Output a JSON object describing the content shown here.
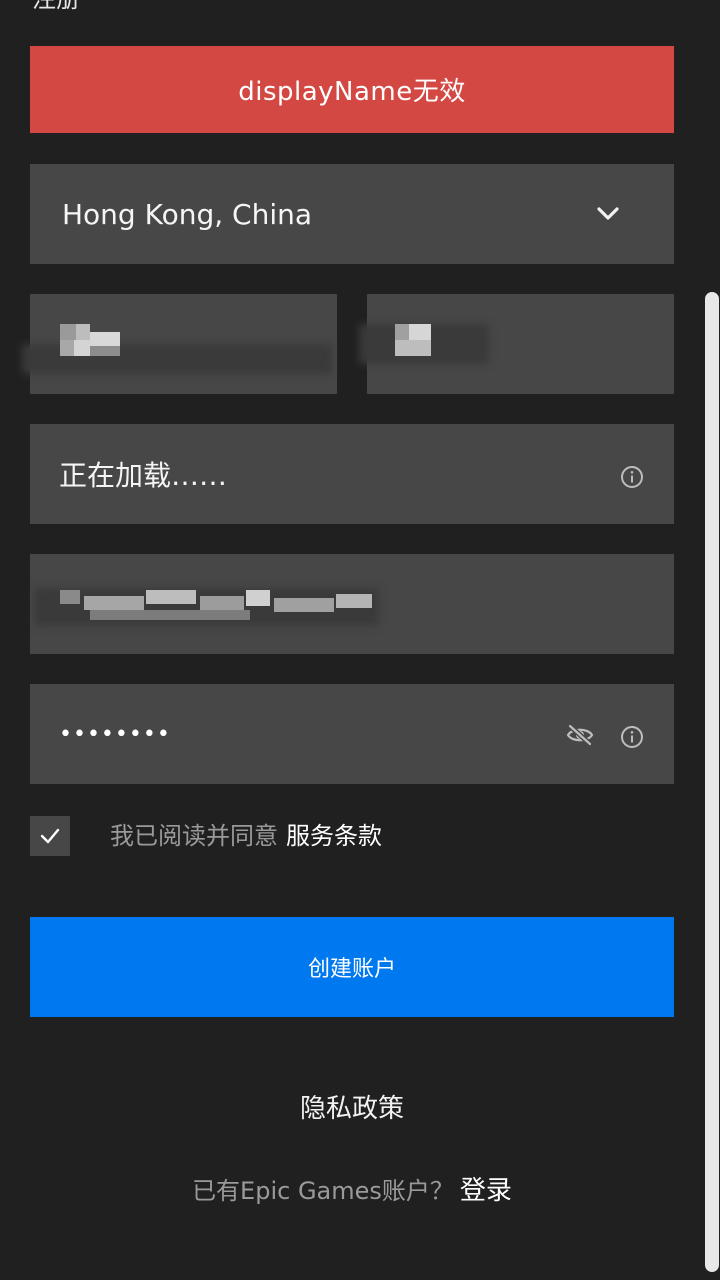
{
  "page": {
    "title": "注册"
  },
  "error_banner": {
    "message": "displayName无效",
    "color": "#d44843"
  },
  "form": {
    "country": {
      "value": "Hong Kong, China"
    },
    "first_name": {
      "value": ""
    },
    "last_name": {
      "value": ""
    },
    "display_name": {
      "value": "正在加载……"
    },
    "email": {
      "value": ""
    },
    "password": {
      "value": "••••••••"
    },
    "terms": {
      "checked": true,
      "prefix": "我已阅读并同意",
      "link": "服务条款"
    },
    "submit_label": "创建账户",
    "submit_color": "#0078f0"
  },
  "footer": {
    "privacy_label": "隐私政策",
    "login_prompt": "已有Epic Games账户？",
    "login_label": "登录"
  },
  "icons": {
    "country": "chevron-down-icon",
    "display_name": "info-icon",
    "password_visibility": "eye-slash-icon",
    "password_info": "info-icon",
    "checkbox": "checkmark-icon"
  }
}
